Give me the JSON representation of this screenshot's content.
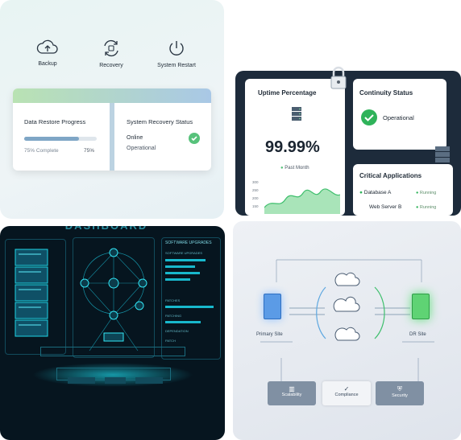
{
  "tile1": {
    "actions": [
      {
        "label": "Backup",
        "icon": "cloud-upload-icon"
      },
      {
        "label": "Recovery",
        "icon": "recovery-cycle-icon"
      },
      {
        "label": "System Restart",
        "icon": "power-icon"
      }
    ],
    "restore": {
      "title": "Data Restore Progress",
      "progress_label": "75% Complete",
      "progress_value": "75%",
      "progress": 0.75
    },
    "recovery": {
      "title": "System Recovery Status",
      "line1": "Online",
      "line2": "Operational"
    }
  },
  "tile2": {
    "uptime": {
      "title": "Uptime Percentage",
      "value": "99.99%",
      "legend": "Past Month",
      "ticks": [
        "300",
        "250",
        "200",
        "150",
        "100",
        "50"
      ]
    },
    "continuity": {
      "title": "Continuity Status",
      "status": "Operational"
    },
    "critical": {
      "title": "Critical Applications",
      "apps": [
        {
          "name": "Database A",
          "status": "Running"
        },
        {
          "name": "Web Server B",
          "status": "Running"
        }
      ]
    }
  },
  "tile3": {
    "banner": "DASHBOARD",
    "panel_title": "SOFTWARE UPGRADES",
    "panel_subtitle": "SOFTWARE UPGRADES",
    "items": [
      "PATCHES",
      "PATCHING",
      "DEPENDATION",
      "PATCH"
    ],
    "colors": {
      "accent": "#19d6e6",
      "bg": "#06151f"
    }
  },
  "tile4": {
    "primary_label": "Primary Site",
    "dr_label": "DR Site",
    "pills": [
      {
        "label": "Scalability",
        "icon": "chart-icon"
      },
      {
        "label": "Compliance",
        "icon": "check-shield-icon"
      },
      {
        "label": "Security",
        "icon": "shield-icon"
      }
    ]
  }
}
